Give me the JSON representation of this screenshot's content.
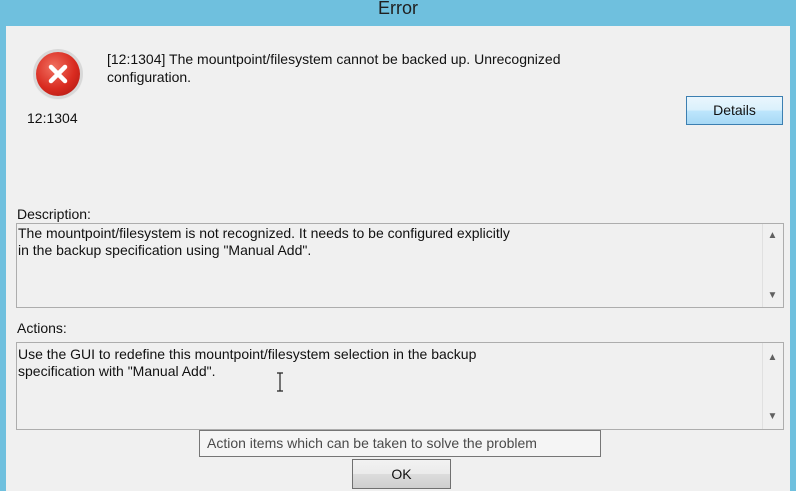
{
  "window": {
    "title": "Error"
  },
  "header": {
    "message": "[12:1304] The mountpoint/filesystem cannot be backed up. Unrecognized configuration.",
    "code": "12:1304",
    "details_label": "Details"
  },
  "description": {
    "label": "Description:",
    "text": "The mountpoint/filesystem is not recognized. It needs to be configured explicitly in the backup specification using \"Manual Add\"."
  },
  "actions": {
    "label": "Actions:",
    "text": "Use the GUI to redefine this mountpoint/filesystem selection in the backup specification with \"Manual Add\"."
  },
  "tooltip": {
    "text": "Action items which can be taken to solve the problem"
  },
  "footer": {
    "ok_label": "OK"
  },
  "icons": {
    "error": "error-x-icon",
    "scroll_up": "scroll-up-icon",
    "scroll_down": "scroll-down-icon",
    "cursor": "text-cursor-icon"
  },
  "colors": {
    "titlebar": "#6fc0de",
    "error_red": "#d92b20",
    "details_border": "#3c7fb1"
  }
}
